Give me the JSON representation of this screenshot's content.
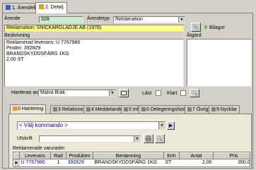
{
  "tabs": [
    {
      "label": "1. Ärendelista"
    },
    {
      "label": "2. Detalj"
    }
  ],
  "form": {
    "arende_label": "Ärende",
    "arende_value": "328",
    "arendetyp_label": "Ärendetyp",
    "arendetyp_value": "Reklamation",
    "reklamation_value": "Reklamation: SNICKARGLÄDJE AB (1978)",
    "bilagor_count": "0",
    "bilagor_label": "Bilagor",
    "beskrivning_label": "Beskrivning",
    "beskrivning_lines": [
      "Reklamerad leverans: U 7767980",
      "Prodnr: 392829",
      "BRANDSKYDDSFÄRG   1KG",
      "2.00 ST"
    ],
    "atgard_label": "Åtgärd",
    "hanteras_label": "Hanteras av",
    "hanteras_value": "Malva Bråk",
    "last_label": "Låst",
    "klart_label": "Klart"
  },
  "bottom_tabs": [
    {
      "label": "0 Hantering"
    },
    {
      "label": "3 Relationer"
    },
    {
      "label": "4 Meddelanden"
    },
    {
      "label": "5 Info"
    },
    {
      "label": "6 Delegeringshistorik"
    },
    {
      "label": "7 Övrigt"
    },
    {
      "label": "9 Nycklar"
    }
  ],
  "kommando": {
    "value": "< Välj kommando >"
  },
  "utskrift": {
    "label": "Utskrift"
  },
  "varuradtable": {
    "title": "Reklamerade varurader",
    "columns": [
      "Leverans",
      "Rad",
      "Produktnr",
      "Benämning",
      "Enh",
      "Antal",
      "Pris"
    ],
    "rows": [
      {
        "leverans": "U 7767980",
        "rad": "1",
        "produktnr": "392829",
        "benamning": "BRANDSKYDDSFÄRG  1KG",
        "enh": "ST",
        "antal": "2,00",
        "pris": "350,00"
      }
    ]
  },
  "colors": {
    "accent": "#0000c0",
    "bilagor_green": "#00a000",
    "arende_bg": "#c8f0c8",
    "rekl_bg": "#ffff80"
  }
}
